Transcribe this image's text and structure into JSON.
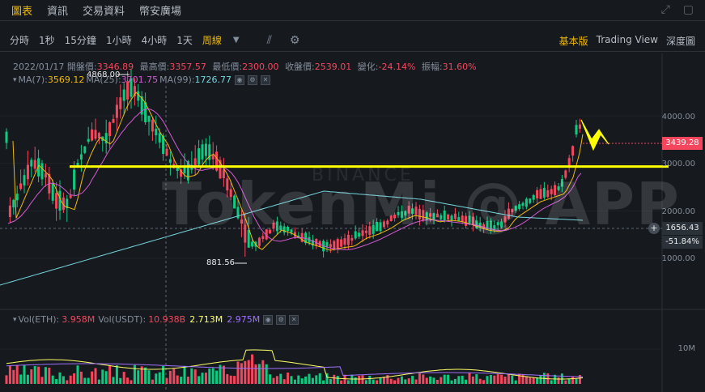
{
  "top_tabs": [
    {
      "label": "圖表",
      "active": true
    },
    {
      "label": "資訊",
      "active": false
    },
    {
      "label": "交易資料",
      "active": false
    },
    {
      "label": "幣安廣場",
      "active": false
    }
  ],
  "intervals": [
    {
      "label": "分時",
      "active": false
    },
    {
      "label": "1秒",
      "active": false
    },
    {
      "label": "15分鐘",
      "active": false
    },
    {
      "label": "1小時",
      "active": false
    },
    {
      "label": "4小時",
      "active": false
    },
    {
      "label": "1天",
      "active": false
    },
    {
      "label": "周線",
      "active": true
    }
  ],
  "views": [
    {
      "label": "基本版",
      "active": true
    },
    {
      "label": "Trading View",
      "active": false
    },
    {
      "label": "深度圖",
      "active": false
    }
  ],
  "ohlc": {
    "date": "2022/01/17",
    "open_label": "開盤價:",
    "open": "3346.89",
    "high_label": "最高價:",
    "high": "3357.57",
    "low_label": "最低價:",
    "low": "2300.00",
    "close_label": "收盤價:",
    "close": "2539.01",
    "change_label": "變化:",
    "change": "-24.14%",
    "amp_label": "振幅:",
    "amp": "31.60%"
  },
  "ma": {
    "ma7_label": "MA(7):",
    "ma7": "3569.12",
    "ma25_label": "MA(25):",
    "ma25": "3701.75",
    "ma99_label": "MA(99):",
    "ma99": "1726.77"
  },
  "vol": {
    "eth_label": "Vol(ETH):",
    "eth": "3.958M",
    "usdt_label": "Vol(USDT):",
    "usdt": "10.938B",
    "v1": "2.713M",
    "v2": "2.975M"
  },
  "axis": {
    "p4000": "4000.00",
    "p3000": "3000.00",
    "p2000": "2000.00",
    "p1000": "1000.00",
    "vol10m": "10M"
  },
  "price_tags": {
    "current": "3439.28",
    "crosshair": "1656.43",
    "crosshair_change": "-51.84%"
  },
  "annotations": {
    "high": "4868.00",
    "low": "881.56"
  },
  "watermark": {
    "main": "TokenMi @ APP",
    "brand": "BINANCE"
  },
  "colors": {
    "up": "#0ecb81",
    "down": "#f6465d",
    "accent": "#f0b90b",
    "ma7": "#f0b90b",
    "ma25": "#d45ad4",
    "ma99": "#76d6e0",
    "resistance_line": "#ffff00"
  },
  "chart_data": {
    "type": "candlestick",
    "interval": "weekly",
    "levels_shown": [
      1000,
      2000,
      3000,
      4000
    ],
    "resistance_level": 3000,
    "current_price": 3439.28,
    "all_time_high": 4868.0,
    "cycle_low": 881.56
  }
}
